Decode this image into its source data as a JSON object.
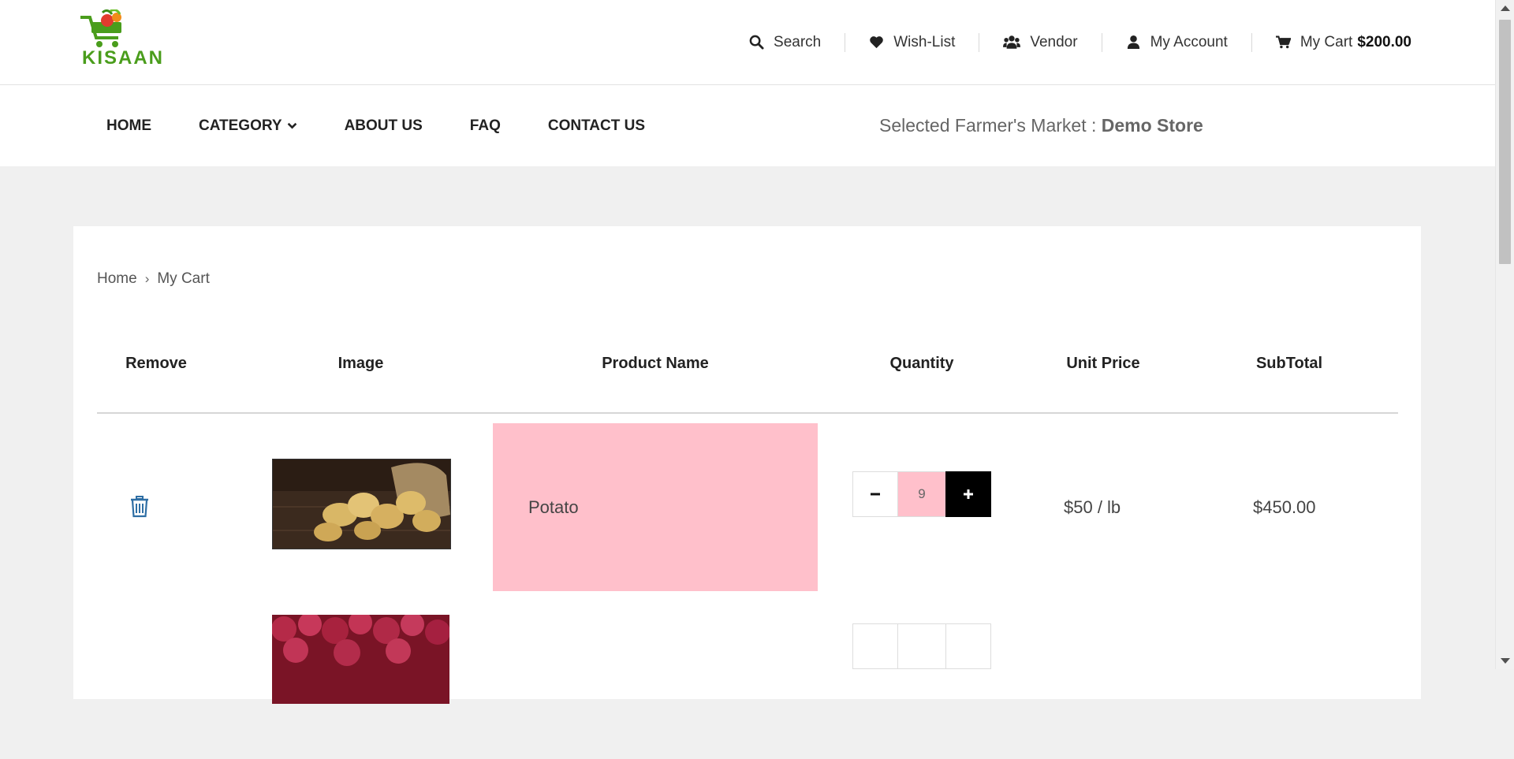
{
  "logo": {
    "text": "KISAAN"
  },
  "header": {
    "links": [
      {
        "label": "Search",
        "icon": "search-icon"
      },
      {
        "label": "Wish-List",
        "icon": "heart-icon"
      },
      {
        "label": "Vendor",
        "icon": "users-icon"
      },
      {
        "label": "My Account",
        "icon": "user-icon"
      }
    ],
    "cart": {
      "label": "My Cart",
      "total": "$200.00",
      "icon": "cart-icon"
    }
  },
  "nav": {
    "items": [
      "HOME",
      "CATEGORY",
      "ABOUT US",
      "FAQ",
      "CONTACT US"
    ],
    "market_label": "Selected Farmer's Market :",
    "market_value": "Demo Store"
  },
  "breadcrumb": {
    "home": "Home",
    "current": "My Cart"
  },
  "table": {
    "headers": [
      "Remove",
      "Image",
      "Product Name",
      "Quantity",
      "Unit Price",
      "SubTotal"
    ],
    "rows": [
      {
        "name": "Potato",
        "quantity": "9",
        "unit_price": "$50 / lb",
        "subtotal": "$450.00",
        "image": "potatoes"
      },
      {
        "name": "",
        "quantity": "",
        "unit_price": "",
        "subtotal": "",
        "image": "onions"
      }
    ]
  },
  "colors": {
    "brand_green": "#4a9d1c",
    "highlight_pink": "#ffc0cb",
    "icon_blue": "#2f6fa5"
  }
}
